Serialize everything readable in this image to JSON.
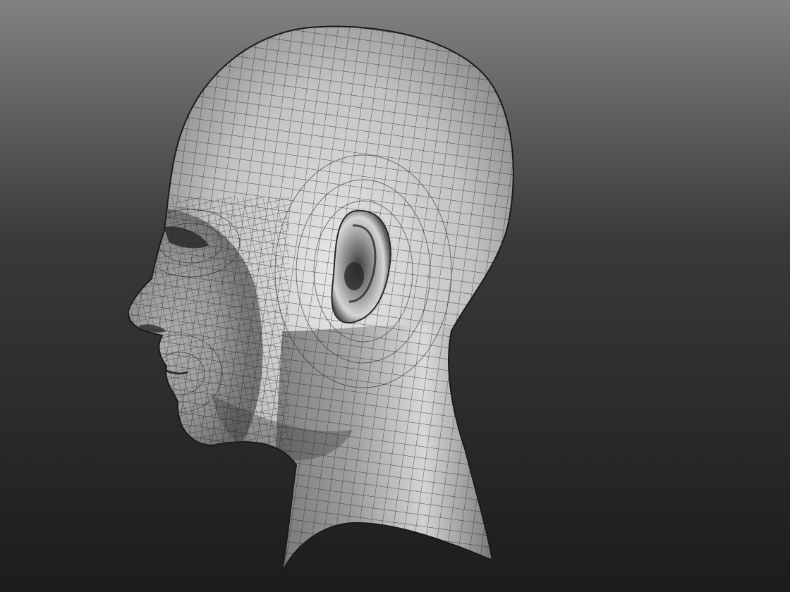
{
  "scene": {
    "subject": "head-mesh",
    "colors": {
      "background_top": "#828282",
      "background_mid": "#3a3a3a",
      "background_bottom": "#1c1c1c",
      "surface_light": "#e6e6e6",
      "surface_mid": "#a8a8a8",
      "surface_dark": "#3c3c3c",
      "wire": "#202020"
    }
  }
}
